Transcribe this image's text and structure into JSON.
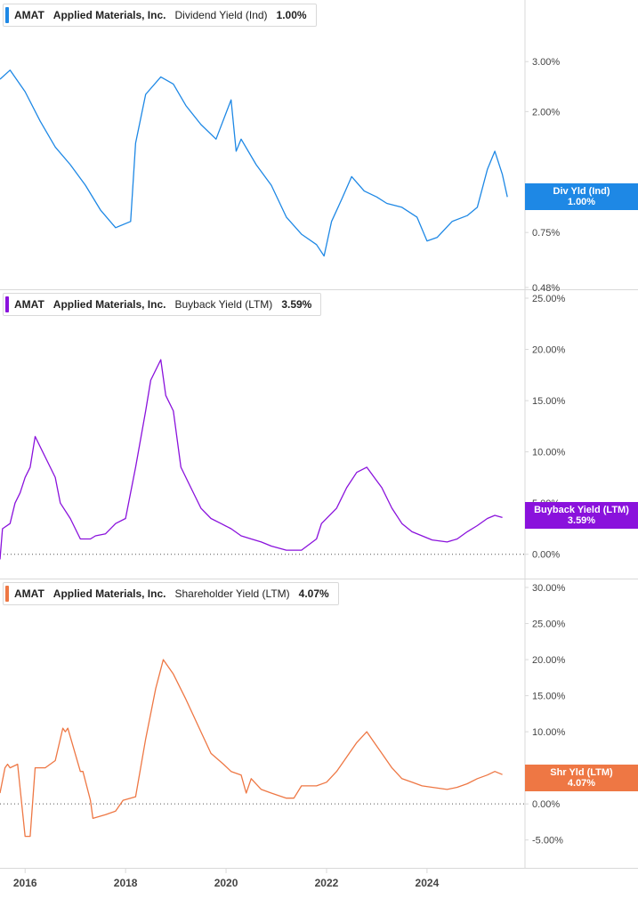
{
  "colors": {
    "dividend": "#1e88e5",
    "buyback": "#8a12dc",
    "shareholder": "#ee7744",
    "grid": "#d9d9d9",
    "text": "#444444"
  },
  "x_axis": {
    "ticks": [
      "2016",
      "2018",
      "2020",
      "2022",
      "2024"
    ],
    "range": [
      2015.5,
      2025.95
    ]
  },
  "chart_data": [
    {
      "type": "line",
      "legend": {
        "ticker": "AMAT",
        "company": "Applied Materials, Inc.",
        "metric": "Dividend Yield (Ind)",
        "value": "1.00%"
      },
      "badge": {
        "label": "Div Yld (Ind)",
        "value": "1.00%"
      },
      "y_ticks": [
        "3.00%",
        "2.00%",
        "0.75%",
        "0.48%"
      ],
      "y_tick_values": [
        3.0,
        2.0,
        0.75,
        0.48
      ],
      "y_scale": "log",
      "ylim": [
        0.48,
        4.6
      ],
      "zero_line": false,
      "series": [
        {
          "x": [
            2015.5,
            2015.7,
            2016.0,
            2016.3,
            2016.6,
            2016.9,
            2017.2,
            2017.5,
            2017.8,
            2018.1,
            2018.2,
            2018.4,
            2018.7,
            2018.95,
            2019.2,
            2019.5,
            2019.8,
            2020.1,
            2020.2,
            2020.3,
            2020.6,
            2020.9,
            2021.2,
            2021.5,
            2021.8,
            2021.95,
            2022.1,
            2022.3,
            2022.5,
            2022.75,
            2023.0,
            2023.2,
            2023.5,
            2023.8,
            2024.0,
            2024.2,
            2024.5,
            2024.8,
            2025.0,
            2025.2,
            2025.35,
            2025.5,
            2025.6
          ],
          "values": [
            2.6,
            2.8,
            2.35,
            1.85,
            1.5,
            1.3,
            1.1,
            0.9,
            0.78,
            0.82,
            1.55,
            2.3,
            2.65,
            2.5,
            2.1,
            1.8,
            1.6,
            2.2,
            1.45,
            1.6,
            1.3,
            1.1,
            0.85,
            0.74,
            0.68,
            0.62,
            0.82,
            0.98,
            1.18,
            1.05,
            1.0,
            0.95,
            0.92,
            0.85,
            0.7,
            0.72,
            0.82,
            0.86,
            0.92,
            1.25,
            1.45,
            1.2,
            1.0
          ]
        }
      ]
    },
    {
      "type": "line",
      "legend": {
        "ticker": "AMAT",
        "company": "Applied Materials, Inc.",
        "metric": "Buyback Yield (LTM)",
        "value": "3.59%"
      },
      "badge": {
        "label": "Buyback Yield (LTM)",
        "value": "3.59%"
      },
      "y_ticks": [
        "25.00%",
        "20.00%",
        "15.00%",
        "10.00%",
        "5.00%",
        "0.00%"
      ],
      "y_tick_values": [
        25,
        20,
        15,
        10,
        5,
        0
      ],
      "y_scale": "linear",
      "ylim": [
        -1.5,
        25
      ],
      "zero_line": true,
      "series": [
        {
          "x": [
            2015.5,
            2015.55,
            2015.7,
            2015.8,
            2015.9,
            2016.0,
            2016.1,
            2016.2,
            2016.4,
            2016.6,
            2016.7,
            2016.9,
            2017.1,
            2017.3,
            2017.4,
            2017.6,
            2017.8,
            2018.0,
            2018.2,
            2018.4,
            2018.5,
            2018.7,
            2018.8,
            2018.95,
            2019.1,
            2019.3,
            2019.5,
            2019.7,
            2019.9,
            2020.1,
            2020.3,
            2020.5,
            2020.7,
            2020.9,
            2021.2,
            2021.5,
            2021.8,
            2021.9,
            2022.2,
            2022.4,
            2022.6,
            2022.8,
            2022.95,
            2023.1,
            2023.3,
            2023.5,
            2023.7,
            2023.9,
            2024.1,
            2024.4,
            2024.6,
            2024.8,
            2025.0,
            2025.2,
            2025.35,
            2025.5
          ],
          "values": [
            -0.5,
            2.5,
            3.0,
            5.0,
            6.0,
            7.5,
            8.5,
            11.5,
            9.5,
            7.5,
            5.0,
            3.5,
            1.5,
            1.5,
            1.8,
            2.0,
            3.0,
            3.5,
            8.5,
            14.0,
            17.0,
            19.0,
            15.5,
            14.0,
            8.5,
            6.5,
            4.5,
            3.5,
            3.0,
            2.5,
            1.8,
            1.5,
            1.2,
            0.8,
            0.4,
            0.4,
            1.5,
            3.0,
            4.5,
            6.5,
            8.0,
            8.5,
            7.5,
            6.5,
            4.5,
            3.0,
            2.2,
            1.8,
            1.4,
            1.2,
            1.5,
            2.2,
            2.8,
            3.5,
            3.8,
            3.59
          ]
        }
      ]
    },
    {
      "type": "line",
      "legend": {
        "ticker": "AMAT",
        "company": "Applied Materials, Inc.",
        "metric": "Shareholder Yield (LTM)",
        "value": "4.07%"
      },
      "badge": {
        "label": "Shr Yld (LTM)",
        "value": "4.07%"
      },
      "y_ticks": [
        "30.00%",
        "25.00%",
        "20.00%",
        "15.00%",
        "10.00%",
        "5.00%",
        "0.00%",
        "-5.00%"
      ],
      "y_tick_values": [
        30,
        25,
        20,
        15,
        10,
        5,
        0,
        -5
      ],
      "y_scale": "linear",
      "ylim": [
        -8,
        30
      ],
      "zero_line": true,
      "series": [
        {
          "x": [
            2015.5,
            2015.6,
            2015.65,
            2015.7,
            2015.85,
            2016.0,
            2016.1,
            2016.2,
            2016.4,
            2016.6,
            2016.75,
            2016.8,
            2016.85,
            2017.1,
            2017.15,
            2017.3,
            2017.35,
            2017.6,
            2017.8,
            2017.95,
            2018.2,
            2018.4,
            2018.6,
            2018.75,
            2018.95,
            2019.2,
            2019.5,
            2019.7,
            2019.95,
            2020.1,
            2020.3,
            2020.4,
            2020.5,
            2020.7,
            2020.9,
            2021.2,
            2021.35,
            2021.5,
            2021.8,
            2022.0,
            2022.2,
            2022.4,
            2022.6,
            2022.8,
            2022.95,
            2023.1,
            2023.3,
            2023.5,
            2023.7,
            2023.9,
            2024.1,
            2024.4,
            2024.6,
            2024.8,
            2025.0,
            2025.2,
            2025.35,
            2025.5
          ],
          "values": [
            1.5,
            5.0,
            5.5,
            5.0,
            5.5,
            -4.5,
            -4.5,
            5.0,
            5.0,
            6.0,
            10.5,
            10.0,
            10.5,
            4.5,
            4.5,
            0.5,
            -2.0,
            -1.5,
            -1.0,
            0.5,
            1.0,
            9.0,
            16.0,
            20.0,
            18.0,
            14.5,
            10.0,
            7.0,
            5.5,
            4.5,
            4.0,
            1.5,
            3.5,
            2.0,
            1.5,
            0.8,
            0.8,
            2.5,
            2.5,
            3.0,
            4.5,
            6.5,
            8.5,
            10.0,
            8.5,
            7.0,
            5.0,
            3.5,
            3.0,
            2.5,
            2.3,
            2.0,
            2.3,
            2.8,
            3.5,
            4.0,
            4.5,
            4.07
          ]
        }
      ]
    }
  ]
}
